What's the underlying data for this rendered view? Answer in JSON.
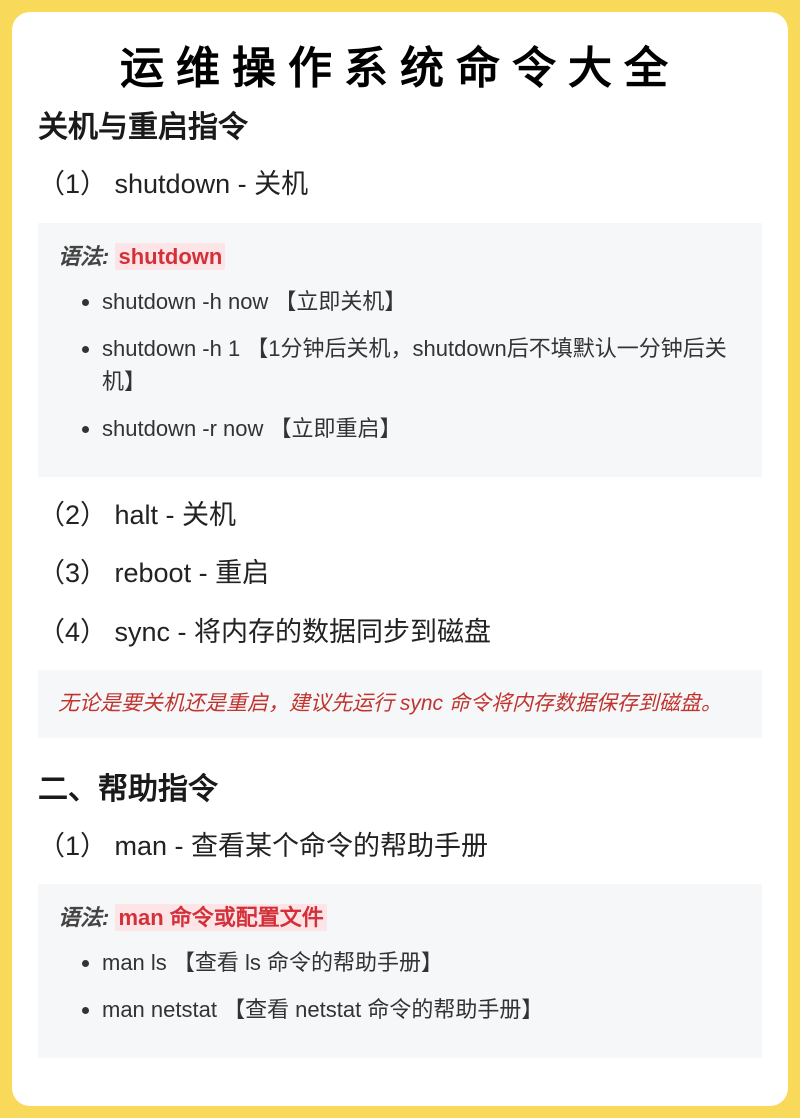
{
  "title": "运维操作系统命令大全",
  "section1": {
    "heading": "关机与重启指令",
    "items": {
      "i1": "（1） shutdown - 关机",
      "i2": "（2） halt - 关机",
      "i3": "（3） reboot - 重启",
      "i4": "（4） sync - 将内存的数据同步到磁盘"
    },
    "code1": {
      "syntax_label": "语法:",
      "syntax_cmd": "shutdown",
      "bullets": {
        "b1": "shutdown -h now 【立即关机】",
        "b2": "shutdown -h 1 【1分钟后关机，shutdown后不填默认一分钟后关机】",
        "b3": "shutdown -r now 【立即重启】"
      }
    },
    "note": "无论是要关机还是重启，建议先运行 sync 命令将内存数据保存到磁盘。"
  },
  "section2": {
    "heading": "二、帮助指令",
    "items": {
      "i1": "（1） man - 查看某个命令的帮助手册"
    },
    "code1": {
      "syntax_label": "语法:",
      "syntax_cmd": "man 命令或配置文件",
      "bullets": {
        "b1": "man ls 【查看 ls 命令的帮助手册】",
        "b2": "man netstat 【查看 netstat 命令的帮助手册】"
      }
    }
  }
}
